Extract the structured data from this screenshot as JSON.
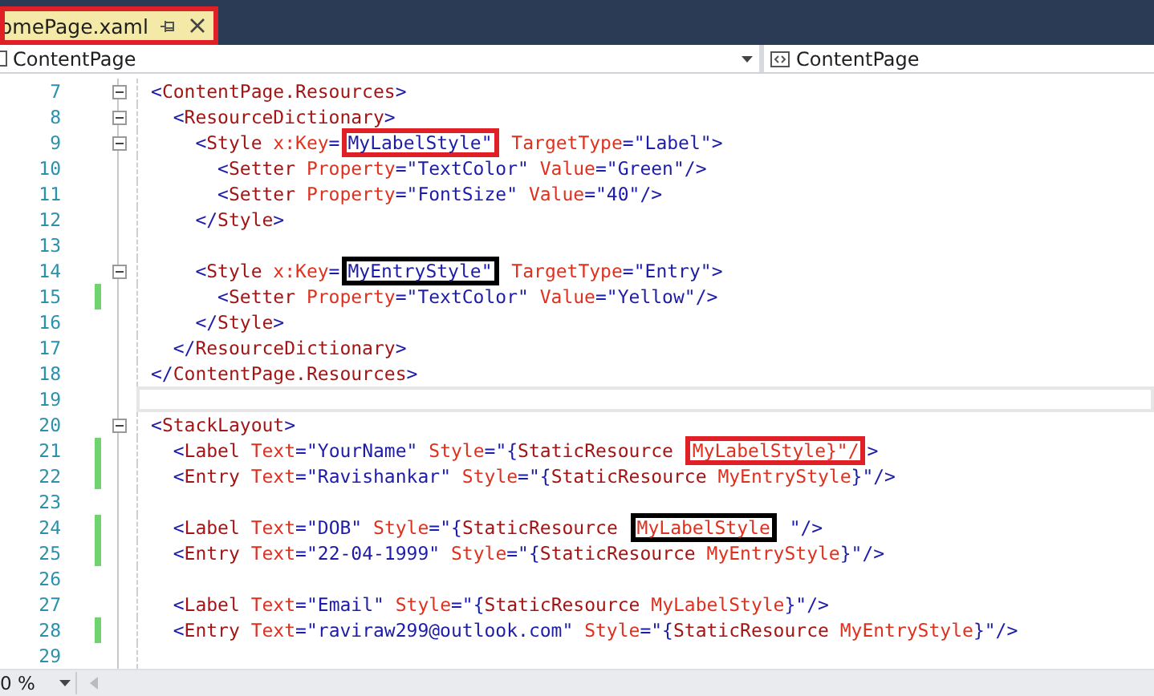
{
  "tab": {
    "title": "omePage.xaml",
    "color": "#e01f26"
  },
  "nav": {
    "left": "ContentPage",
    "right": "ContentPage"
  },
  "lines": [
    {
      "number": "7",
      "fold": true,
      "changed": false,
      "current": false,
      "tokens": [
        {
          "kind": "punct",
          "text": "<"
        },
        {
          "kind": "tag",
          "text": "ContentPage.Resources"
        },
        {
          "kind": "punct",
          "text": ">"
        }
      ]
    },
    {
      "number": "8",
      "fold": true,
      "changed": false,
      "current": false,
      "tokens": [
        {
          "kind": "punct",
          "text": "  <"
        },
        {
          "kind": "tag",
          "text": "ResourceDictionary"
        },
        {
          "kind": "punct",
          "text": ">"
        }
      ]
    },
    {
      "number": "9",
      "fold": true,
      "changed": false,
      "current": false,
      "tokens": [
        {
          "kind": "punct",
          "text": "    <"
        },
        {
          "kind": "tag",
          "text": "Style"
        },
        {
          "kind": "attr",
          "text": " x:Key"
        },
        {
          "kind": "punct",
          "text": "="
        },
        {
          "kind": "value",
          "text": "MyLabelStyle\"",
          "color": "#e01f26"
        },
        {
          "kind": "attr",
          "text": " TargetType"
        },
        {
          "kind": "punct",
          "text": "=\""
        },
        {
          "kind": "value",
          "text": "Label"
        },
        {
          "kind": "punct",
          "text": "\">"
        }
      ]
    },
    {
      "number": "10",
      "fold": false,
      "changed": false,
      "current": false,
      "tokens": [
        {
          "kind": "punct",
          "text": "      <"
        },
        {
          "kind": "tag",
          "text": "Setter"
        },
        {
          "kind": "attr",
          "text": " Property"
        },
        {
          "kind": "punct",
          "text": "=\""
        },
        {
          "kind": "value",
          "text": "TextColor"
        },
        {
          "kind": "punct",
          "text": "\""
        },
        {
          "kind": "attr",
          "text": " Value"
        },
        {
          "kind": "punct",
          "text": "=\""
        },
        {
          "kind": "value",
          "text": "Green"
        },
        {
          "kind": "punct",
          "text": "\"/>"
        }
      ]
    },
    {
      "number": "11",
      "fold": false,
      "changed": false,
      "current": false,
      "tokens": [
        {
          "kind": "punct",
          "text": "      <"
        },
        {
          "kind": "tag",
          "text": "Setter"
        },
        {
          "kind": "attr",
          "text": " Property"
        },
        {
          "kind": "punct",
          "text": "=\""
        },
        {
          "kind": "value",
          "text": "FontSize"
        },
        {
          "kind": "punct",
          "text": "\""
        },
        {
          "kind": "attr",
          "text": " Value"
        },
        {
          "kind": "punct",
          "text": "=\""
        },
        {
          "kind": "value",
          "text": "40"
        },
        {
          "kind": "punct",
          "text": "\"/>"
        }
      ]
    },
    {
      "number": "12",
      "fold": false,
      "changed": false,
      "current": false,
      "tokens": [
        {
          "kind": "punct",
          "text": "    </"
        },
        {
          "kind": "tag",
          "text": "Style"
        },
        {
          "kind": "punct",
          "text": ">"
        }
      ]
    },
    {
      "number": "13",
      "fold": false,
      "changed": false,
      "current": false
    },
    {
      "number": "14",
      "fold": true,
      "changed": false,
      "current": false,
      "tokens": [
        {
          "kind": "punct",
          "text": "    <"
        },
        {
          "kind": "tag",
          "text": "Style"
        },
        {
          "kind": "attr",
          "text": " x:Key"
        },
        {
          "kind": "punct",
          "text": "="
        },
        {
          "kind": "value",
          "text": "MyEntryStyle\"",
          "color": "#000000"
        },
        {
          "kind": "attr",
          "text": " TargetType"
        },
        {
          "kind": "punct",
          "text": "=\""
        },
        {
          "kind": "value",
          "text": "Entry"
        },
        {
          "kind": "punct",
          "text": "\">"
        }
      ]
    },
    {
      "number": "15",
      "fold": false,
      "changed": true,
      "current": false,
      "tokens": [
        {
          "kind": "punct",
          "text": "      <"
        },
        {
          "kind": "tag",
          "text": "Setter"
        },
        {
          "kind": "attr",
          "text": " Property"
        },
        {
          "kind": "punct",
          "text": "=\""
        },
        {
          "kind": "value",
          "text": "TextColor"
        },
        {
          "kind": "punct",
          "text": "\""
        },
        {
          "kind": "attr",
          "text": " Value"
        },
        {
          "kind": "punct",
          "text": "=\""
        },
        {
          "kind": "value",
          "text": "Yellow"
        },
        {
          "kind": "punct",
          "text": "\"/>"
        }
      ]
    },
    {
      "number": "16",
      "fold": false,
      "changed": false,
      "current": false,
      "tokens": [
        {
          "kind": "punct",
          "text": "    </"
        },
        {
          "kind": "tag",
          "text": "Style"
        },
        {
          "kind": "punct",
          "text": ">"
        }
      ]
    },
    {
      "number": "17",
      "fold": false,
      "changed": false,
      "current": false,
      "tokens": [
        {
          "kind": "punct",
          "text": "  </"
        },
        {
          "kind": "tag",
          "text": "ResourceDictionary"
        },
        {
          "kind": "punct",
          "text": ">"
        }
      ]
    },
    {
      "number": "18",
      "fold": false,
      "changed": false,
      "current": false,
      "tokens": [
        {
          "kind": "punct",
          "text": "</"
        },
        {
          "kind": "tag",
          "text": "ContentPage.Resources"
        },
        {
          "kind": "punct",
          "text": ">"
        }
      ]
    },
    {
      "number": "19",
      "fold": false,
      "changed": false,
      "current": true
    },
    {
      "number": "20",
      "fold": true,
      "changed": false,
      "current": false,
      "tokens": [
        {
          "kind": "punct",
          "text": "<"
        },
        {
          "kind": "tag",
          "text": "StackLayout"
        },
        {
          "kind": "punct",
          "text": ">"
        }
      ]
    },
    {
      "number": "21",
      "fold": false,
      "changed": true,
      "current": false,
      "tokens": [
        {
          "kind": "punct",
          "text": "  <"
        },
        {
          "kind": "tag",
          "text": "Label"
        },
        {
          "kind": "attr",
          "text": " Text"
        },
        {
          "kind": "punct",
          "text": "=\""
        },
        {
          "kind": "value",
          "text": "YourName"
        },
        {
          "kind": "punct",
          "text": "\""
        },
        {
          "kind": "attr",
          "text": " Style"
        },
        {
          "kind": "punct",
          "text": "=\"{"
        },
        {
          "kind": "tag",
          "text": "StaticResource "
        },
        {
          "kind": "attr",
          "text": "MyLabelStyle}\"/",
          "color": "#e01f26"
        },
        {
          "kind": "punct",
          "text": ">"
        }
      ]
    },
    {
      "number": "22",
      "fold": false,
      "changed": true,
      "current": false,
      "tokens": [
        {
          "kind": "punct",
          "text": "  <"
        },
        {
          "kind": "tag",
          "text": "Entry"
        },
        {
          "kind": "attr",
          "text": " Text"
        },
        {
          "kind": "punct",
          "text": "=\""
        },
        {
          "kind": "value",
          "text": "Ravishankar"
        },
        {
          "kind": "punct",
          "text": "\""
        },
        {
          "kind": "attr",
          "text": " Style"
        },
        {
          "kind": "punct",
          "text": "=\"{"
        },
        {
          "kind": "tag",
          "text": "StaticResource"
        },
        {
          "kind": "attr",
          "text": " MyEntryStyle"
        },
        {
          "kind": "punct",
          "text": "}\"/>"
        }
      ]
    },
    {
      "number": "23",
      "fold": false,
      "changed": false,
      "current": false
    },
    {
      "number": "24",
      "fold": false,
      "changed": true,
      "current": false,
      "tokens": [
        {
          "kind": "punct",
          "text": "  <"
        },
        {
          "kind": "tag",
          "text": "Label"
        },
        {
          "kind": "attr",
          "text": " Text"
        },
        {
          "kind": "punct",
          "text": "=\""
        },
        {
          "kind": "value",
          "text": "DOB"
        },
        {
          "kind": "punct",
          "text": "\""
        },
        {
          "kind": "attr",
          "text": " Style"
        },
        {
          "kind": "punct",
          "text": "=\"{"
        },
        {
          "kind": "tag",
          "text": "StaticResource "
        },
        {
          "kind": "attr",
          "text": "MyLabelStyle",
          "color": "#000000"
        },
        {
          "kind": "punct",
          "text": " \"/>"
        }
      ]
    },
    {
      "number": "25",
      "fold": false,
      "changed": true,
      "current": false,
      "tokens": [
        {
          "kind": "punct",
          "text": "  <"
        },
        {
          "kind": "tag",
          "text": "Entry"
        },
        {
          "kind": "attr",
          "text": " Text"
        },
        {
          "kind": "punct",
          "text": "=\""
        },
        {
          "kind": "value",
          "text": "22-04-1999"
        },
        {
          "kind": "punct",
          "text": "\""
        },
        {
          "kind": "attr",
          "text": " Style"
        },
        {
          "kind": "punct",
          "text": "=\"{"
        },
        {
          "kind": "tag",
          "text": "StaticResource"
        },
        {
          "kind": "attr",
          "text": " MyEntryStyle"
        },
        {
          "kind": "punct",
          "text": "}\"/>"
        }
      ]
    },
    {
      "number": "26",
      "fold": false,
      "changed": false,
      "current": false
    },
    {
      "number": "27",
      "fold": false,
      "changed": false,
      "current": false,
      "tokens": [
        {
          "kind": "punct",
          "text": "  <"
        },
        {
          "kind": "tag",
          "text": "Label"
        },
        {
          "kind": "attr",
          "text": " Text"
        },
        {
          "kind": "punct",
          "text": "=\""
        },
        {
          "kind": "value",
          "text": "Email"
        },
        {
          "kind": "punct",
          "text": "\""
        },
        {
          "kind": "attr",
          "text": " Style"
        },
        {
          "kind": "punct",
          "text": "=\"{"
        },
        {
          "kind": "tag",
          "text": "StaticResource"
        },
        {
          "kind": "attr",
          "text": " MyLabelStyle"
        },
        {
          "kind": "punct",
          "text": "}\"/>"
        }
      ]
    },
    {
      "number": "28",
      "fold": false,
      "changed": true,
      "current": false,
      "tokens": [
        {
          "kind": "punct",
          "text": "  <"
        },
        {
          "kind": "tag",
          "text": "Entry"
        },
        {
          "kind": "attr",
          "text": " Text"
        },
        {
          "kind": "punct",
          "text": "=\""
        },
        {
          "kind": "value",
          "text": "raviraw299@outlook.com"
        },
        {
          "kind": "punct",
          "text": "\""
        },
        {
          "kind": "attr",
          "text": " Style"
        },
        {
          "kind": "punct",
          "text": "=\"{"
        },
        {
          "kind": "tag",
          "text": "StaticResource"
        },
        {
          "kind": "attr",
          "text": " MyEntryStyle"
        },
        {
          "kind": "punct",
          "text": "}\"/>"
        }
      ]
    },
    {
      "number": "29",
      "fold": false,
      "changed": false,
      "current": false
    }
  ],
  "zoom": "0 %"
}
